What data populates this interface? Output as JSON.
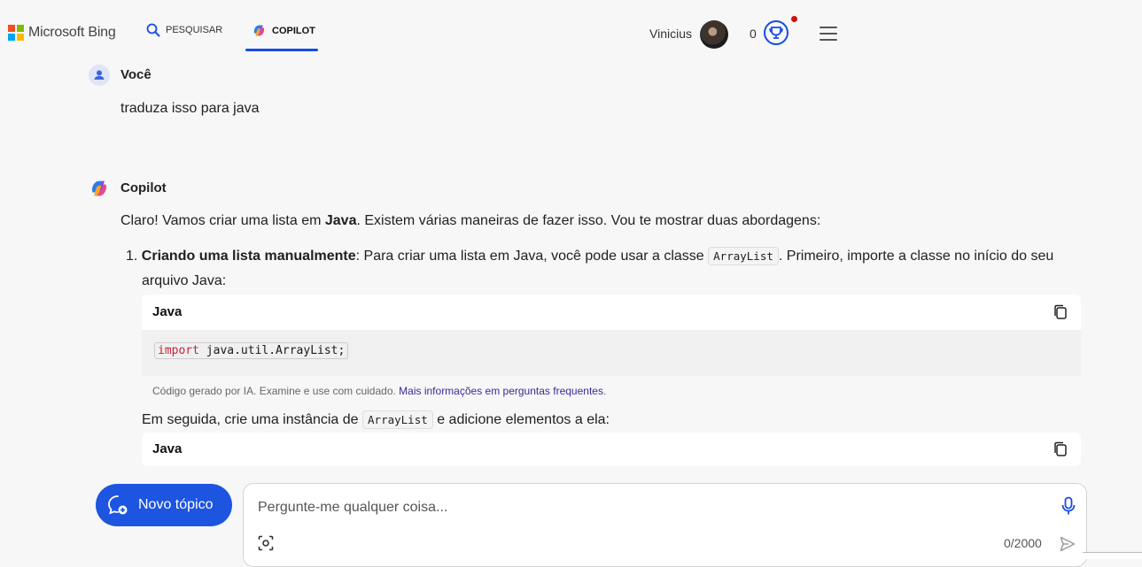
{
  "header": {
    "logo_text": "Microsoft Bing",
    "tabs": [
      {
        "label": "PESQUISAR",
        "icon": "search-icon",
        "active": false
      },
      {
        "label": "COPILOT",
        "icon": "copilot-icon",
        "active": true
      }
    ],
    "user_name": "Vinicius",
    "points": "0",
    "accent_color": "#174ae4"
  },
  "conversation": {
    "user_message": {
      "author": "Você",
      "text": "traduza isso para java"
    },
    "copilot_message": {
      "author": "Copilot",
      "intro_prefix": "Claro! Vamos criar uma lista em ",
      "intro_bold": "Java",
      "intro_suffix": ". Existem várias maneiras de fazer isso. Vou te mostrar duas abordagens:",
      "step1_number": "1.",
      "step1_title": "Criando uma lista manualmente",
      "step1_text_a": ": Para criar uma lista em Java, você pode usar a classe ",
      "step1_code": "ArrayList",
      "step1_text_b": ". Primeiro, importe a classe no início do seu",
      "step1_text_c": "arquivo Java:",
      "code_block_1": {
        "language": "Java",
        "keyword": "import",
        "code_rest": " java.util.ArrayList;"
      },
      "disclaimer_text": "Código gerado por IA. Examine e use com cuidado. ",
      "disclaimer_link": "Mais informações em perguntas frequentes",
      "disclaimer_end": ".",
      "followup_prefix": "Em seguida, crie uma instância de ",
      "followup_code": "ArrayList",
      "followup_suffix": " e adicione elementos a ela:",
      "code_block_2": {
        "language": "Java"
      }
    }
  },
  "composer": {
    "new_topic_label": "Novo tópico",
    "placeholder": "Pergunte-me qualquer coisa...",
    "char_counter": "0/2000",
    "brand_color": "#1d55e0"
  }
}
